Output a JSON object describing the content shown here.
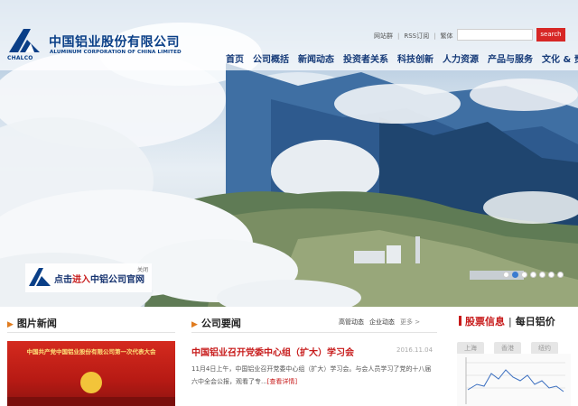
{
  "header": {
    "company_cn": "中国铝业股份有限公司",
    "company_en": "ALUMINUM CORPORATION OF CHINA LIMITED",
    "logo_abbr": "CHALCO",
    "utility_links": [
      "网站群",
      "RSS订阅",
      "繁体"
    ],
    "search": {
      "placeholder": "",
      "button_label": "search"
    }
  },
  "nav": {
    "items": [
      "首页",
      "公司概括",
      "新闻动态",
      "投资者关系",
      "科技创新",
      "人力资源",
      "产品与服务",
      "文化 & 责任"
    ]
  },
  "hero": {
    "promo": {
      "text_prefix": "点击",
      "text_highlight": "进入",
      "text_suffix": "中铝公司官网",
      "close_label": "关闭"
    },
    "slide_count": 7,
    "active_slide": 2
  },
  "photo_news": {
    "title": "图片新闻",
    "banner_text": "中国共产党中国铝业股份有限公司第一次代表大会"
  },
  "company_news": {
    "title": "公司要闻",
    "tabs": [
      "高管动态",
      "企业动态",
      "更多 >"
    ],
    "headline": "中国铝业召开党委中心组（扩大）学习会",
    "date": "2016.11.04",
    "summary": "11月4日上午，中国铝业召开党委中心组（扩大）学习会。与会人员学习了党的十八届六中全会公报，观看了专...",
    "detail_link": "[查看详情]"
  },
  "stock": {
    "title": "股票信息",
    "title2": "每日铝价",
    "tabs": [
      "上海",
      "香港",
      "纽约"
    ]
  },
  "colors": {
    "brand_blue": "#0a3f87",
    "accent_red": "#d72726",
    "nav_text": "#153a78"
  }
}
